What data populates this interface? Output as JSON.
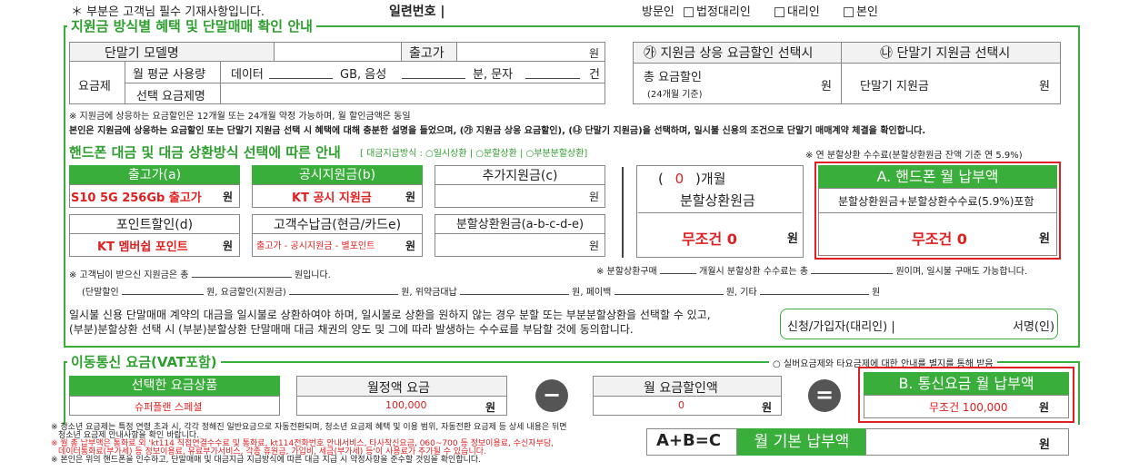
{
  "header": {
    "required_note": "＊ 부분은 고객님 필수 기재사항입니다.",
    "serial_label": "일련번호 |",
    "visitor_label": "방문인",
    "options": [
      "법정대리인",
      "대리인",
      "본인"
    ]
  },
  "section1": {
    "title": "지원금 방식별 혜택 및 단말매매 확인 안내",
    "model_label": "단말기 모델명",
    "price_label": "출고가",
    "won": "원",
    "plan_label": "요금제",
    "avg_usage_label": "월 평균 사용량",
    "data_label": "데이터",
    "gb_voice": "GB, 음성",
    "min_text": "분, 문자",
    "count_unit": "건",
    "selected_plan_label": "선택 요금제명",
    "option_a_header": "㉮ 지원금 상응 요금할인 선택시",
    "option_b_header": "㉯ 단말기 지원금 선택시",
    "total_discount_label": "총 요금할인",
    "total_discount_sub": "(24개월 기준)",
    "device_subsidy_label": "단말기 지원금",
    "note1": "※ 지원금에 상응하는 요금할인은 12개월 또는 24개월 약정 가능하며, 월 할인금액은 동일",
    "note2": "본인은 지원금에 상응하는 요금할인 또는 단말기 지원금 선택 시 혜택에 대해 충분한 설명을 들었으며, (㉮ 지원금 상응 요금할인), (㉯ 단말기 지원금)을 선택하며, 일시불 신용의 조건으로 단말기 매매계약 체결을 확인합니다."
  },
  "section2": {
    "title": "핸드폰 대금 및 대금 상환방식 선택에 따른 안내",
    "title_sub": "[ 대금지급방식 : ○일시상환 | ○분할상환 | ○부분분할상환]",
    "rate_note": "※ 연 분할상환 수수료(분할상환원금 잔액 기준 연 5.9%)",
    "price_a_label": "출고가(a)",
    "price_a_value": "S10 5G 256Gb 출고가",
    "subsidy_b_label": "공시지원금(b)",
    "subsidy_b_value": "KT 공시 지원금",
    "extra_c_label": "추가지원금(c)",
    "point_d_label": "포인트할인(d)",
    "point_d_value": "KT 멤버쉽 포인트",
    "customer_e_label": "고객수납금(현금/카드e)",
    "customer_e_value": "출고가 - 공시지원금 - 별포인트",
    "install_label": "분할상환원금(a-b-c-d-e)",
    "months_open": "(",
    "months_value": "0",
    "months_close": ")개월",
    "principal_label": "분할상환원금",
    "unconditional_zero": "무조건 0",
    "monthly_a_title": "A. 핸드폰 월 납부액",
    "monthly_a_sub": "분할상환원금+분할상환수수료(5.9%)포함",
    "note_received": "※ 고객님이 받으신 지원금은 총",
    "note_received_unit": "원입니다.",
    "note_install": "※ 분할상환구매",
    "note_install_mid": "개월시 분할상환 수수료는 총",
    "note_install_end": "원이며, 일시불 구매도 가능합니다.",
    "detail_items": [
      "(단말할인",
      "원, 요금할인(지원금)",
      "원, 위약금대납",
      "원, 페이백",
      "원, 기타",
      "원"
    ],
    "agree_text1": "일시불 신용 단말매매 계약의 대금을 일시불로 상환하여야 하며, 일시불로 상환을 원하지 않는 경우 분할 또는 부분분할상환을 선택할 수 있고,",
    "agree_text2": "(부분)분할상환 선택 시 (부분)분할상환 단말매매 대금 채권의 양도 및 그에 따라 발생하는 수수료를 부담할 것에 동의합니다.",
    "signer_label": "신청/가입자(대리인) |",
    "signature_label": "서명(인)"
  },
  "section3": {
    "title": "이동통신 요금(VAT포함)",
    "senior_note": "○ 실버요금제와 타요금제에 대한 안내를 별지를 통해 받음",
    "plan_header": "선택한 요금상품",
    "plan_value": "슈퍼플랜 스페셜",
    "monthly_fee_header": "월정액 요금",
    "monthly_fee_value": "100,000",
    "discount_header": "월 요금할인액",
    "discount_value": "0",
    "minus_symbol": "−",
    "equals_symbol": "=",
    "b_title": "B. 통신요금 월 납부액",
    "b_value": "무조건 100,000",
    "formula": "A+B=C",
    "base_payment_label": "월 기본 납부액",
    "footnotes": [
      "※ 청소년 요금제는 특정 연령 초과 시, 각각 정해진 일반요금으로 자동전환되며, 청소년 요금제 혜택 및 이용 범위, 자동전환 요금제 등 상세 내용은 뒤면",
      "청소년 요금제 안내사항을 확인 바랍니다.",
      "※ 월 총 납부액은 통화료 외 'kt114 직접연결수수료 및 통화료, kt114전화번호 안내서비스, 타사착신요금, 060~700 등 정보이용료, 수신자부담,",
      "데이터통화료(부가세) 등 정보이용료, 유료부가서비스, 각종 휴원금, 가입비, 세금(부가세) 등'이 사용료가 추가될 수 있습니다.",
      "※ 본인은 위의 핸드폰을 인수하고, 단말매매 및 대금지급 지급방식에 따른 대금 지급 시 약정사항을 준수할 것임을 확인합니다."
    ]
  },
  "colors": {
    "green": "#3aae3a",
    "red": "#e02020",
    "dark_circle": "#555555"
  }
}
